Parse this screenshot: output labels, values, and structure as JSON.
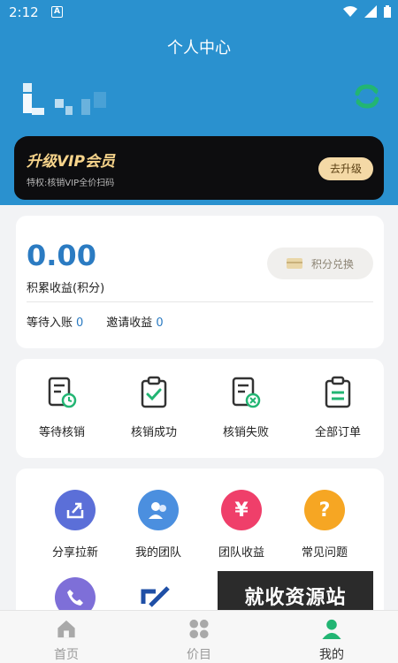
{
  "status_bar": {
    "time": "2:12",
    "app_badge": "A"
  },
  "header": {
    "title": "个人中心"
  },
  "user": {
    "name_blurred": "(blurred user name)"
  },
  "vip": {
    "title": "升级VIP会员",
    "subtitle": "特权:核销VIP全价扫码",
    "button": "去升级"
  },
  "earnings": {
    "amount": "0.00",
    "label": "积累收益(积分)",
    "exchange_button": "积分兑换",
    "pending_label": "等待入账",
    "pending_value": "0",
    "invite_label": "邀请收益",
    "invite_value": "0"
  },
  "orders": {
    "items": [
      {
        "label": "等待核销",
        "icon": "clock-document-icon"
      },
      {
        "label": "核销成功",
        "icon": "clipboard-check-icon"
      },
      {
        "label": "核销失败",
        "icon": "document-x-icon"
      },
      {
        "label": "全部订单",
        "icon": "clipboard-list-icon"
      }
    ]
  },
  "services": {
    "items": [
      {
        "label": "分享拉新",
        "icon": "share-icon",
        "color": "#5b6fd8"
      },
      {
        "label": "我的团队",
        "icon": "team-icon",
        "color": "#4b8fdf"
      },
      {
        "label": "团队收益",
        "icon": "yen-icon",
        "color": "#ef3f6a"
      },
      {
        "label": "常见问题",
        "icon": "question-icon",
        "color": "#f6a623"
      },
      {
        "label": "",
        "icon": "phone-icon",
        "color": "#7e6fd8"
      },
      {
        "label": "",
        "icon": "link-icon",
        "color": "#1f4fa6"
      }
    ]
  },
  "watermark": {
    "text": "就收资源站"
  },
  "tabbar": {
    "items": [
      {
        "label": "首页",
        "icon": "home-icon"
      },
      {
        "label": "价目",
        "icon": "grid-icon"
      },
      {
        "label": "我的",
        "icon": "profile-icon"
      }
    ],
    "active": "我的"
  },
  "colors": {
    "primary": "#2a91cf",
    "vip_gold": "#f7d48b",
    "accent_green": "#22b573"
  }
}
